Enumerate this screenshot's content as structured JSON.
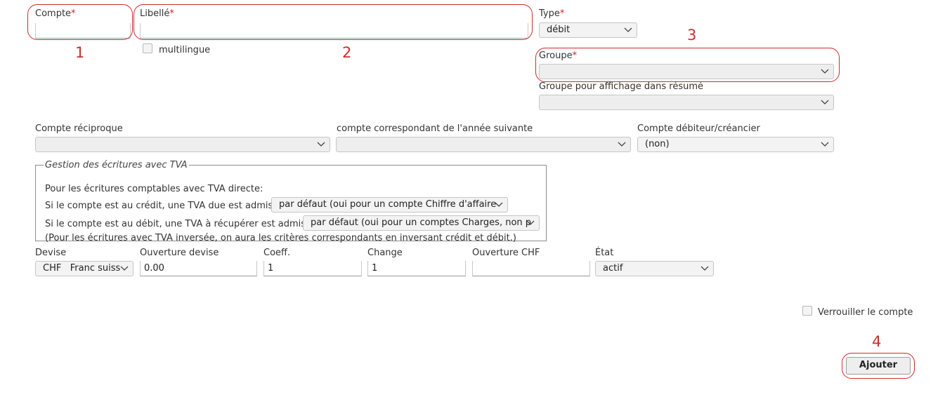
{
  "form": {
    "compte": {
      "label": "Compte",
      "required_mark": "*",
      "value": ""
    },
    "libelle": {
      "label": "Libellé",
      "required_mark": "*",
      "value": ""
    },
    "multilingue_label": "multilingue",
    "type": {
      "label": "Type",
      "required_mark": "*",
      "value": "débit"
    },
    "groupe": {
      "label": "Groupe",
      "required_mark": "*",
      "value": ""
    },
    "groupe_affichage": {
      "label": "Groupe pour affichage dans résumé",
      "value": ""
    },
    "compte_reciproque": {
      "label": "Compte réciproque",
      "value": ""
    },
    "compte_annee_suivante": {
      "label": "compte correspondant de l'année suivante",
      "value": ""
    },
    "compte_debiteur": {
      "label": "Compte débiteur/créancier",
      "value": "(non)"
    },
    "tva": {
      "legend": "Gestion des écritures avec TVA",
      "intro": "Pour les écritures comptables avec TVA directe:",
      "credit_label": "Si le compte est au crédit, une TVA due est admise:",
      "credit_value": "par défaut (oui pour un compte Chiffre d'affaire",
      "debit_label": "Si le compte est au débit, une TVA à récupérer est admise:",
      "debit_value": "par défaut (oui pour un comptes Charges, non p",
      "note": "(Pour les écritures avec TVA inversée, on aura les critères correspondants en inversant crédit et débit.)"
    },
    "devise": {
      "label": "Devise",
      "code": "CHF",
      "name": "Franc suiss"
    },
    "ouverture_devise": {
      "label": "Ouverture devise",
      "value": "0.00"
    },
    "coeff": {
      "label": "Coeff.",
      "value": "1"
    },
    "change": {
      "label": "Change",
      "value": "1"
    },
    "ouverture_chf": {
      "label": "Ouverture CHF",
      "value": ""
    },
    "etat": {
      "label": "État",
      "value": "actif"
    },
    "verrouiller_label": "Verrouiller le compte",
    "ajouter_label": "Ajouter"
  },
  "annotations": {
    "n1": "1",
    "n2": "2",
    "n3": "3",
    "n4": "4",
    "color": "#d42a2a"
  },
  "icons": {
    "select_arrow": "chevron-down-icon",
    "checkbox": "checkbox-icon"
  }
}
